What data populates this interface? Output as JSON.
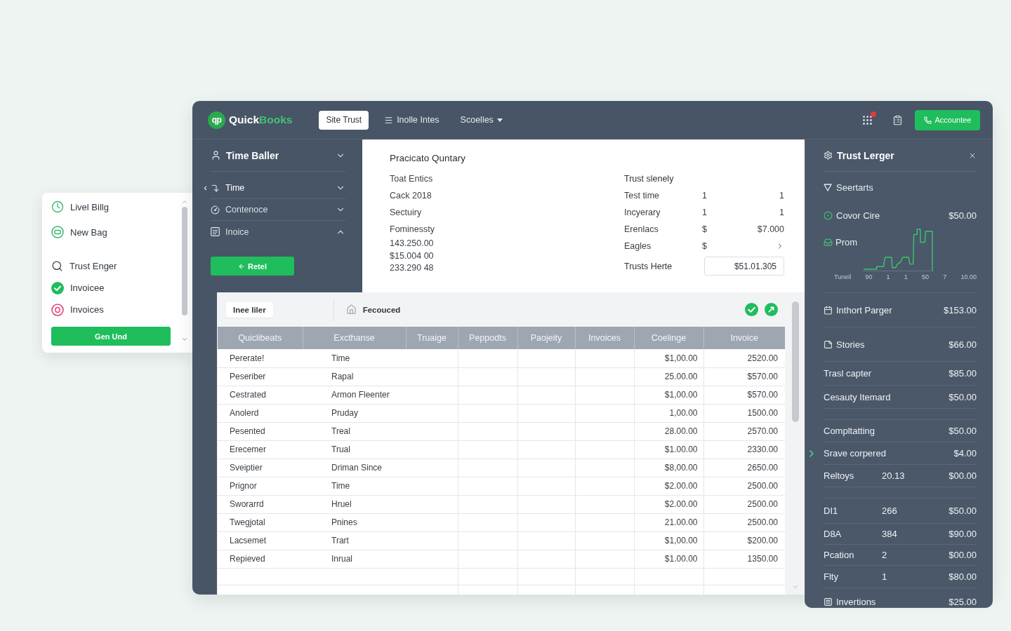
{
  "side_popup": {
    "groups": [
      [
        {
          "label": "Livel Billg"
        },
        {
          "label": "New Bag"
        }
      ],
      [
        {
          "label": "Trust Enger"
        },
        {
          "label": "Invoicee"
        },
        {
          "label": "Invoices"
        }
      ]
    ],
    "button": "Gen Und"
  },
  "top_bar": {
    "logo_mark": "qp",
    "brand_first": "Quick",
    "brand_second": "Books",
    "chip": "Site Trust",
    "menus": [
      {
        "label": "Inolle Intes",
        "kind": "list"
      },
      {
        "label": "Scoelles",
        "kind": "dropdown"
      }
    ],
    "action_button": "Accountee"
  },
  "sidebar": {
    "title": "Time Baller",
    "items": [
      {
        "label": "Time",
        "selected": true,
        "expanded": false
      },
      {
        "label": "Contenoce",
        "selected": false,
        "expanded": false
      },
      {
        "label": "Inoice",
        "selected": false,
        "expanded": true
      }
    ],
    "button": "Retel"
  },
  "summary": {
    "title": "Pracicato Quntary",
    "labels": [
      "Toat Entics",
      "Cack 2018",
      "Sectuiry",
      "Fominessty"
    ],
    "figures": [
      "143.250.00",
      "$15.004 00",
      "233.290 48"
    ],
    "right_title": "Trust slenely",
    "right_rows": [
      {
        "kind": "text",
        "label": "Test time",
        "column_2": "1",
        "column_3": "1"
      },
      {
        "kind": "text",
        "label": "Incyerary",
        "column_2": "1",
        "column_3": "1"
      },
      {
        "kind": "text",
        "label": "Erenlacs",
        "column_2": "$",
        "column_3": "$7.000"
      },
      {
        "kind": "link",
        "label": "Eagles",
        "column_2": "$"
      }
    ],
    "total_label": "Trusts Herte",
    "total_value": "$51.01.305"
  },
  "table_panel": {
    "tabs": [
      {
        "label": "Inee Iiler",
        "kind": "plain",
        "selected": true
      },
      {
        "label": "Fecouced",
        "kind": "home",
        "selected": false
      }
    ],
    "columns": [
      "Quiclibeats",
      "Excthanse",
      "Truaige",
      "Peppodts",
      "Paojeity",
      "Invoices",
      "Coelinge",
      "Invoice"
    ],
    "rows": [
      {
        "column_1": "Pererate!",
        "column_2": "Time",
        "column_7": "$1,00.00",
        "column_8": "2520.00"
      },
      {
        "column_1": "Peseriber",
        "column_2": "Rapal",
        "column_7": "25.00.00",
        "column_8": "$570.00"
      },
      {
        "column_1": "Cestrated",
        "column_2": "Armon Fleenter",
        "column_7": "$1,00.00",
        "column_8": "$570.00"
      },
      {
        "column_1": "Anolerd",
        "column_2": "Pruday",
        "column_7": "1,00.00",
        "column_8": "1500.00"
      },
      {
        "column_1": "Pesented",
        "column_2": "Treal",
        "column_7": "28.00.00",
        "column_8": "2570.00"
      },
      {
        "column_1": "Erecemer",
        "column_2": "Trual",
        "column_7": "$1.00.00",
        "column_8": "2330.00"
      },
      {
        "column_1": "Sveiptier",
        "column_2": "Driman Since",
        "column_7": "$8,00.00",
        "column_8": "2650.00"
      },
      {
        "column_1": "Prignor",
        "column_2": "Time",
        "column_7": "$2.00.00",
        "column_8": "2500.00"
      },
      {
        "column_1": "Sworarrd",
        "column_2": "Hruel",
        "column_7": "$2.00.00",
        "column_8": "2500.00"
      },
      {
        "column_1": "Twegjotal",
        "column_2": "Pnines",
        "column_7": "21.00.00",
        "column_8": "2500.00"
      },
      {
        "column_1": "Lacsemet",
        "column_2": "Trart",
        "column_7": "$1,00.00",
        "column_8": "$200.00"
      },
      {
        "column_1": "Repieved",
        "column_2": "Inrual",
        "column_7": "$1.00.00",
        "column_8": "1350.00"
      }
    ]
  },
  "trust_ledger": {
    "title": "Trust Lerger",
    "filter": "Seertarts",
    "headline": {
      "label": "Covor Cire",
      "amount": "$50.00"
    },
    "chart_label": "Prom",
    "axis_labels": [
      "Tuneil",
      "90",
      "1",
      "1",
      "50",
      "7",
      "10.00"
    ],
    "sections": [
      {
        "rows": [
          {
            "kind": "tagged",
            "label": "Inthort Parger",
            "amount": "$153.00"
          },
          {
            "kind": "tagged",
            "label": "Stories",
            "amount": "$66.00"
          },
          {
            "kind": "plain",
            "label": "Trasl capter",
            "amount": "$85.00"
          },
          {
            "kind": "plain",
            "label": "Cesauty Itemard",
            "amount": "$50.00"
          }
        ]
      },
      {
        "rows": [
          {
            "kind": "plain",
            "label": "Compltatting",
            "amount": "$50.00"
          },
          {
            "kind": "plain",
            "label": "Srave corpered",
            "amount": "$4.00"
          },
          {
            "kind": "plain",
            "label": "Reltoys",
            "quantity": "20.13",
            "amount": "$00.00"
          }
        ]
      },
      {
        "rows": [
          {
            "kind": "plain",
            "label": "DI1",
            "quantity": "266",
            "amount": "$50.00"
          },
          {
            "kind": "plain",
            "label": "D8A",
            "quantity": "384",
            "amount": "$90.00"
          },
          {
            "kind": "plain",
            "label": "Pcation",
            "quantity": "2",
            "amount": "$00.00"
          },
          {
            "kind": "plain",
            "label": "Flty",
            "quantity": "1",
            "amount": "$80.00"
          },
          {
            "kind": "tagged",
            "label": "Invertions",
            "amount": "$25.00"
          }
        ]
      }
    ]
  }
}
